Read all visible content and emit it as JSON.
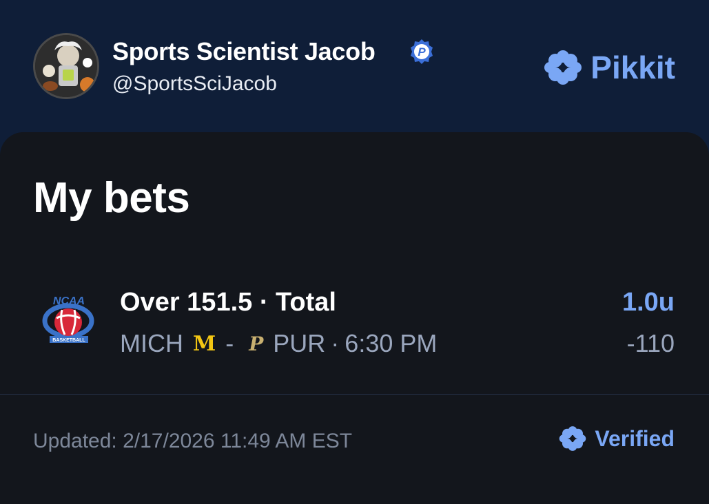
{
  "profile": {
    "name": "Sports Scientist Jacob",
    "handle": "@SportsSciJacob",
    "badge_letter": "P"
  },
  "brand": {
    "name": "Pikkit",
    "icon": "clover-icon",
    "color": "#7aa7f5"
  },
  "page": {
    "title": "My bets"
  },
  "bets": [
    {
      "league_icon": "ncaa-basketball-logo",
      "league_logo_text": "NCAA",
      "league_logo_subtext": "BASKETBALL",
      "description": "Over 151.5 · Total",
      "team_home": "MICH",
      "team_home_logo": "M",
      "dash": "-",
      "team_away_logo": "P",
      "team_away": "PUR",
      "separator": "·",
      "time": "6:30 PM",
      "units": "1.0u",
      "odds": "-110"
    }
  ],
  "footer": {
    "updated": "Updated: 2/17/2026 11:49 AM EST",
    "verified_label": "Verified"
  },
  "colors": {
    "header_bg": "#0f1e38",
    "card_bg": "#13161c",
    "accent": "#7aa7f5",
    "muted": "#9aa6bd"
  }
}
